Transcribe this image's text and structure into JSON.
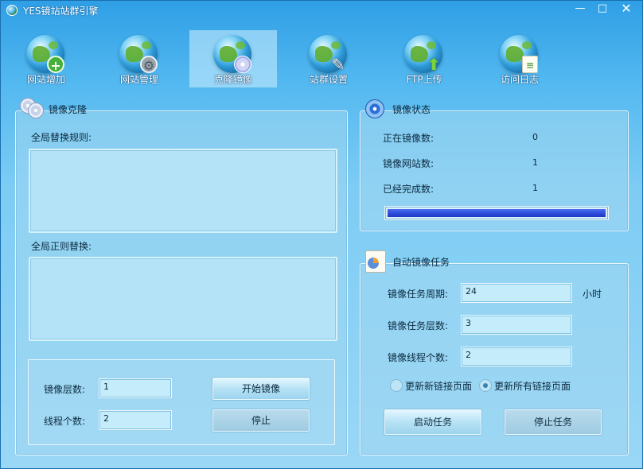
{
  "window": {
    "title": "YES镜站站群引擎",
    "minimize_glyph": "—",
    "maximize_glyph": "□",
    "close_glyph": "✕"
  },
  "toolbar": {
    "items": [
      {
        "label": "网站增加",
        "icon": "globe-add-icon",
        "badge": "+"
      },
      {
        "label": "网站管理",
        "icon": "globe-gear-icon",
        "badge": "⚙"
      },
      {
        "label": "克隆镜像",
        "icon": "globe-disc-icon",
        "badge": ""
      },
      {
        "label": "站群设置",
        "icon": "globe-wrench-icon",
        "badge": "✎"
      },
      {
        "label": "FTP上传",
        "icon": "globe-upload-icon",
        "badge": "⬆"
      },
      {
        "label": "访问日志",
        "icon": "globe-log-icon",
        "badge": "≡"
      }
    ],
    "active_index": 2
  },
  "clone": {
    "title": "镜像克隆",
    "rules_label": "全局替换规则:",
    "rules_value": "",
    "regex_label": "全局正则替换:",
    "regex_value": "",
    "depth_label": "镜像层数:",
    "depth_value": "1",
    "threads_label": "线程个数:",
    "threads_value": "2",
    "start_button": "开始镜像",
    "stop_button": "停止"
  },
  "status": {
    "title": "镜像状态",
    "running_label": "正在镜像数:",
    "running_value": "0",
    "sites_label": "镜像网站数:",
    "sites_value": "1",
    "done_label": "已经完成数:",
    "done_value": "1",
    "progress": 1.0
  },
  "auto": {
    "title": "自动镜像任务",
    "period_label": "镜像任务周期:",
    "period_value": "24",
    "period_unit": "小时",
    "depth_label": "镜像任务层数:",
    "depth_value": "3",
    "threads_label": "镜像线程个数:",
    "threads_value": "2",
    "radio_new_label": "更新新链接页面",
    "radio_all_label": "更新所有链接页面",
    "selected": "all",
    "start_button": "启动任务",
    "stop_button": "停止任务"
  },
  "colors": {
    "accent": "#2f9fe6",
    "progress": "#2a49d8"
  }
}
